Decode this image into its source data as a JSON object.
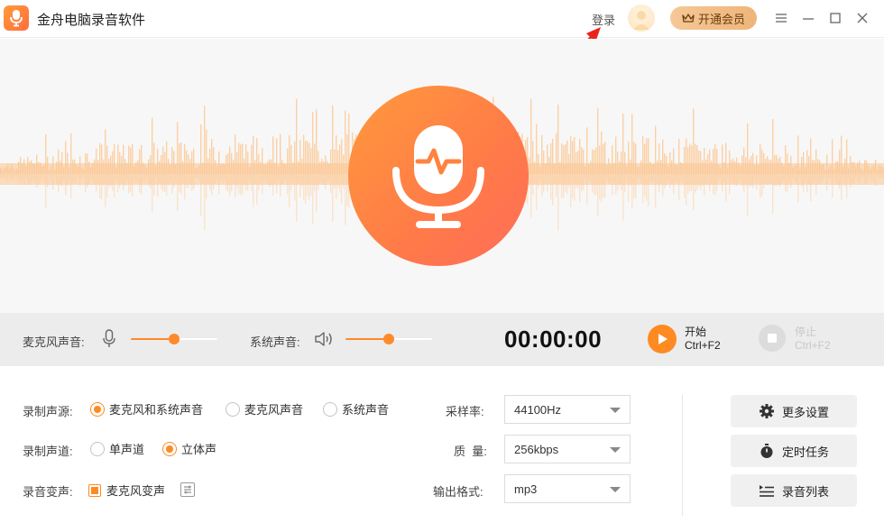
{
  "app": {
    "title": "金舟电脑录音软件"
  },
  "header": {
    "login_label": "登录",
    "vip_label": "开通会员"
  },
  "controls": {
    "mic_volume_label": "麦克风声音:",
    "mic_volume_level": 0.5,
    "system_volume_label": "系统声音:",
    "system_volume_level": 0.5,
    "timer": "00:00:00",
    "start_label": "开始",
    "start_shortcut": "Ctrl+F2",
    "stop_label": "停止",
    "stop_shortcut": "Ctrl+F2"
  },
  "settings": {
    "source_label": "录制声源:",
    "source_options": [
      "麦克风和系统声音",
      "麦克风声音",
      "系统声音"
    ],
    "source_selected": 0,
    "channel_label": "录制声道:",
    "channel_options": [
      "单声道",
      "立体声"
    ],
    "channel_selected": 1,
    "voice_change_label": "录音变声:",
    "voice_change_option": "麦克风变声",
    "voice_change_checked": true,
    "sample_rate_label": "采样率:",
    "sample_rate_value": "44100Hz",
    "quality_label": "质  量:",
    "quality_value": "256kbps",
    "format_label": "输出格式:",
    "format_value": "mp3"
  },
  "side_buttons": {
    "more_settings": "更多设置",
    "scheduled_task": "定时任务",
    "recording_list": "录音列表"
  },
  "colors": {
    "accent": "#ff8a22",
    "wave": "#fcc996"
  }
}
